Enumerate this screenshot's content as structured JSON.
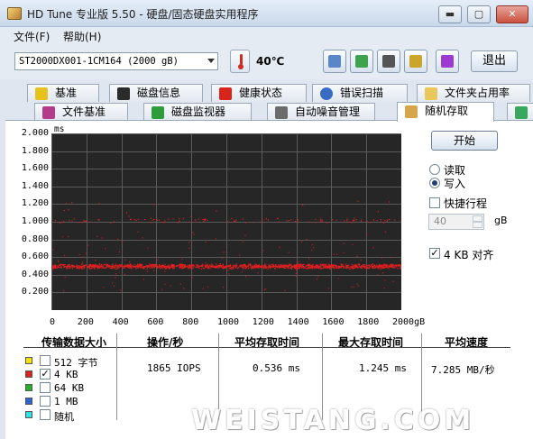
{
  "window": {
    "title": "HD Tune 专业版 5.50 - 硬盘/固态硬盘实用程序",
    "min_glyph": "▬",
    "max_glyph": "▢",
    "close_glyph": "✕"
  },
  "menu": [
    "文件(F)",
    "帮助(H)"
  ],
  "toolbar": {
    "drive": "ST2000DX001-1CM164 (2000 gB)",
    "temperature": "40℃",
    "exit_label": "退出",
    "icons": [
      "copy-info-icon",
      "copy-screen-icon",
      "camera-icon",
      "options-icon",
      "download-icon"
    ]
  },
  "tabs_row1": [
    "基准",
    "磁盘信息",
    "健康状态",
    "错误扫描",
    "文件夹占用率"
  ],
  "tabs_row2": [
    "文件基准",
    "磁盘监视器",
    "自动噪音管理",
    "随机存取"
  ],
  "active_tab": "随机存取",
  "chart_data": {
    "type": "scatter",
    "y_unit": "ms",
    "x_unit": "gB",
    "y_ticks": [
      "2.000",
      "1.800",
      "1.600",
      "1.400",
      "1.200",
      "1.000",
      "0.800",
      "0.600",
      "0.400",
      "0.200"
    ],
    "x_ticks": [
      "0",
      "200",
      "400",
      "600",
      "800",
      "1000",
      "1200",
      "1400",
      "1600",
      "1800",
      "2000gB"
    ],
    "ylim": [
      0,
      2.0
    ],
    "xlim": [
      0,
      2000
    ],
    "grid": true,
    "series": [
      {
        "name": "4 KB",
        "color": "#e02020",
        "band_center": 0.5,
        "band_spread": 0.03,
        "outlier_band": 1.02
      }
    ]
  },
  "side": {
    "start_label": "开始",
    "read_label": "读取",
    "write_label": "写入",
    "mode_selected": "write",
    "short_stroke_label": "快捷行程",
    "short_stroke_value": "40",
    "short_stroke_unit": "gB",
    "align_label": "4 KB 对齐"
  },
  "table": {
    "headers": [
      "传输数据大小",
      "操作/秒",
      "平均存取时间",
      "最大存取时间",
      "平均速度"
    ],
    "rows": [
      {
        "label": "512 字节",
        "color": "#f2e300",
        "checked": false,
        "ops": "",
        "avg": "",
        "max": "",
        "speed": ""
      },
      {
        "label": "4 KB",
        "color": "#e02020",
        "checked": true,
        "ops": "1865 IOPS",
        "avg": "0.536 ms",
        "max": "1.245 ms",
        "speed": "7.285 MB/秒"
      },
      {
        "label": "64 KB",
        "color": "#22b322",
        "checked": false,
        "ops": "",
        "avg": "",
        "max": "",
        "speed": ""
      },
      {
        "label": "1 MB",
        "color": "#2a63d6",
        "checked": false,
        "ops": "",
        "avg": "",
        "max": "",
        "speed": ""
      },
      {
        "label": "随机",
        "color": "#2fe0e8",
        "checked": false,
        "ops": "",
        "avg": "",
        "max": "",
        "speed": ""
      }
    ]
  },
  "watermark": "WEISTANG.COM"
}
